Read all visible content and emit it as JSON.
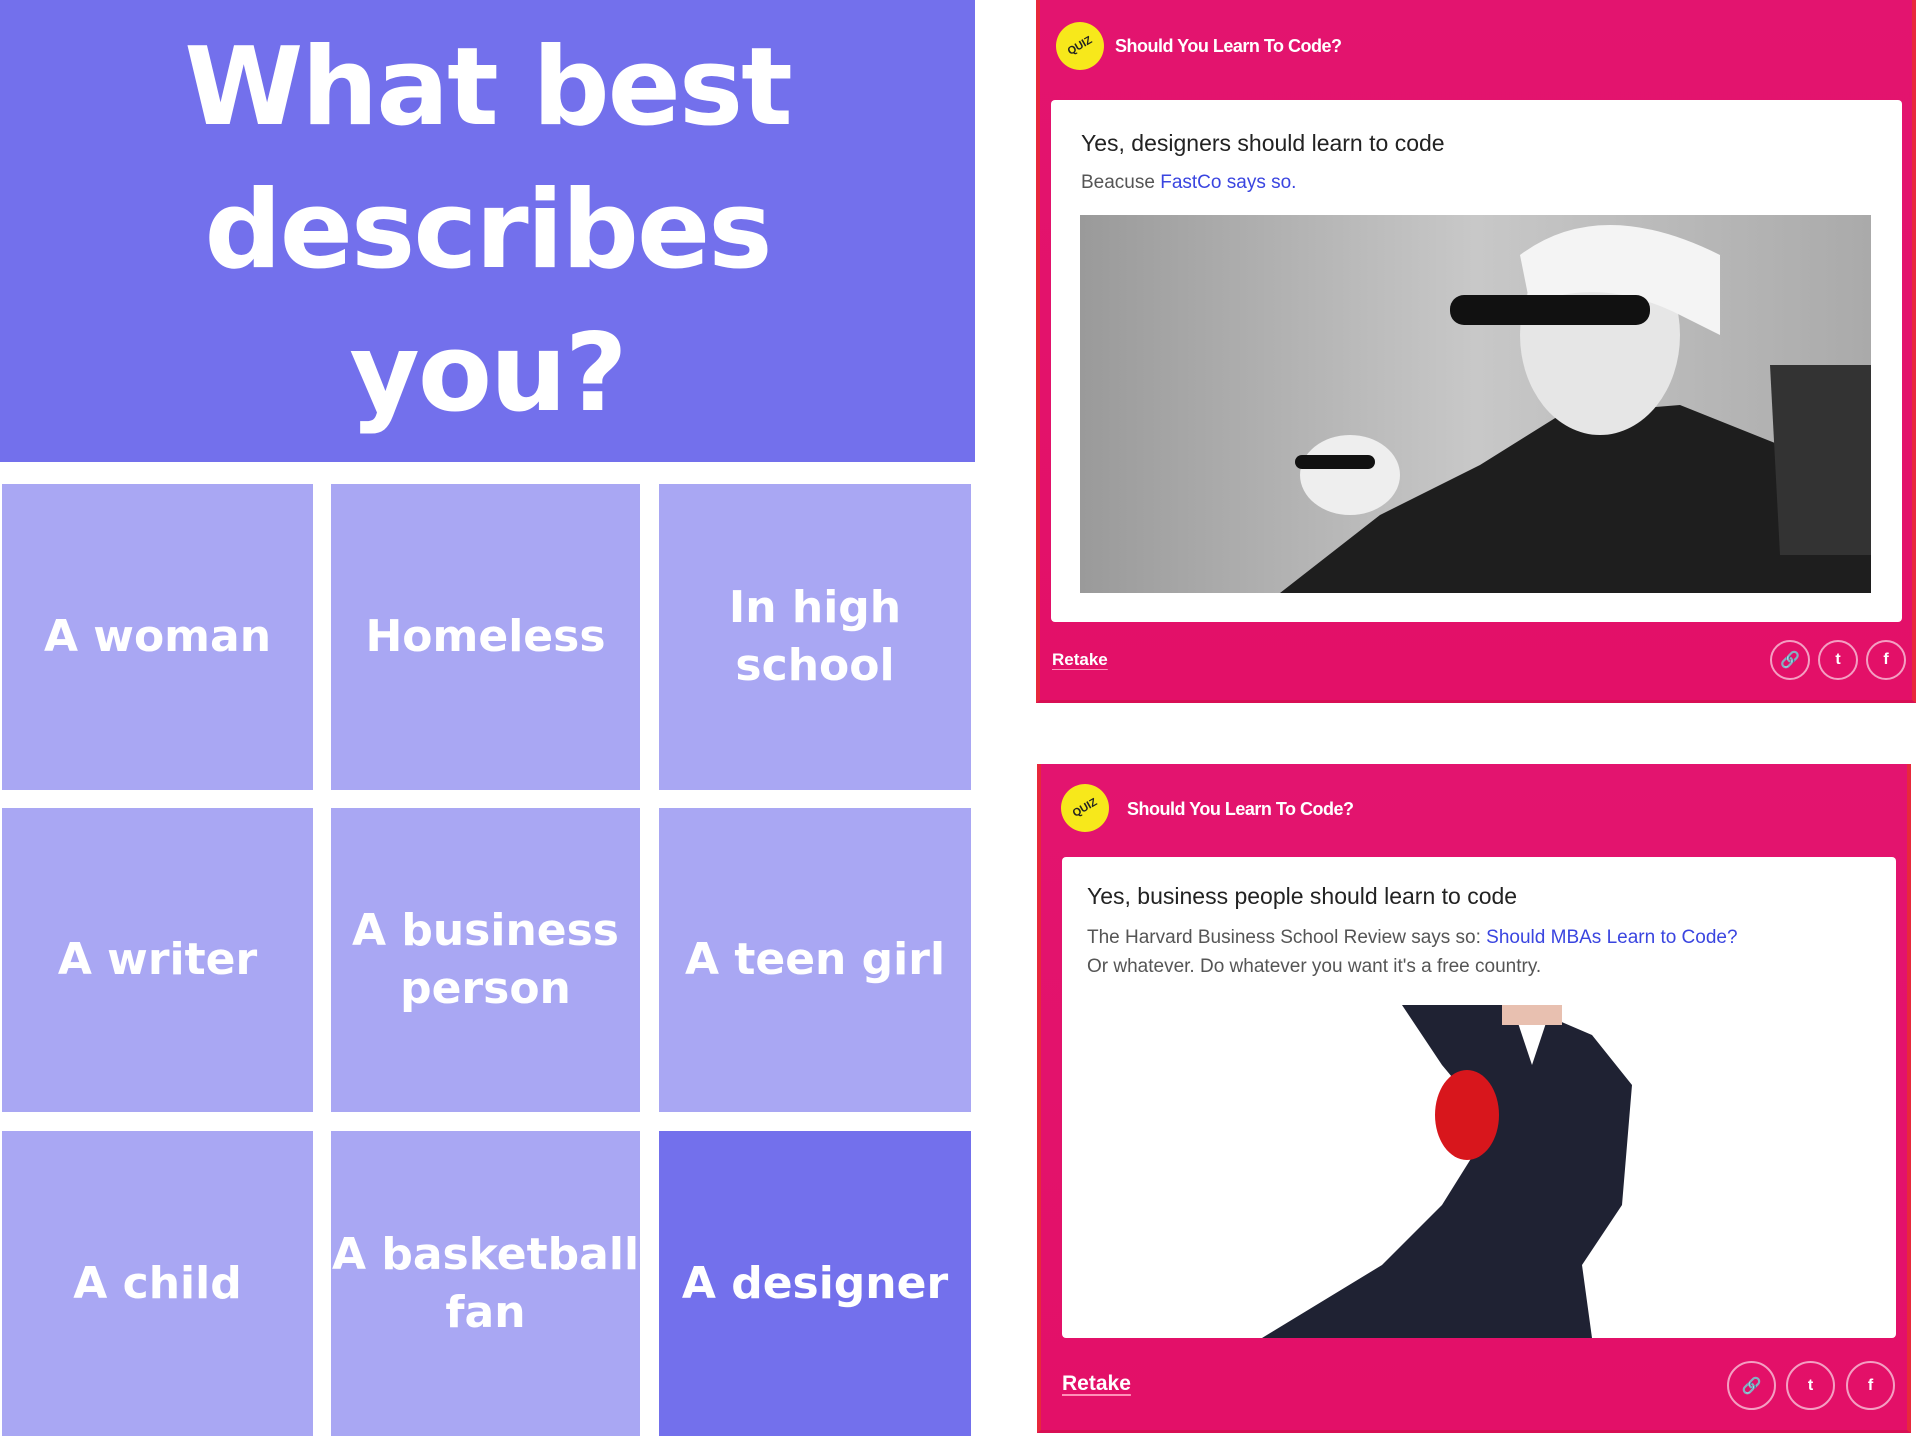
{
  "quiz": {
    "question_lines": [
      "What best",
      "describes",
      "you?"
    ],
    "options": [
      "A woman",
      "Homeless",
      "In high\nschool",
      "A writer",
      "A business\nperson",
      "A teen girl",
      "A child",
      "A basketball\nfan",
      "A designer"
    ],
    "selected": "A designer",
    "colors": {
      "header": "#7370ec",
      "option": "#a9a7f3",
      "selected": "#7370ec"
    }
  },
  "results": [
    {
      "badge": "QUIZ",
      "title": "Should You Learn To Code?",
      "heading": "Yes, designers should learn to code",
      "text": "Beacuse ",
      "link": "FastCo says so.",
      "text2": "",
      "retake": "Retake",
      "icons": [
        "link-icon",
        "twitter-icon",
        "facebook-icon"
      ]
    },
    {
      "badge": "QUIZ",
      "title": "Should You Learn To Code?",
      "heading": "Yes, business people should learn to code",
      "text": "The Harvard Business School Review says so: ",
      "link": "Should MBAs Learn to Code?",
      "text2": "Or whatever. Do whatever you want it's a free country.",
      "retake": "Retake",
      "icons": [
        "link-icon",
        "twitter-icon",
        "facebook-icon"
      ]
    }
  ],
  "colors": {
    "card": "#e3146f",
    "link": "#3a45e0",
    "badge": "#f7e81b"
  }
}
